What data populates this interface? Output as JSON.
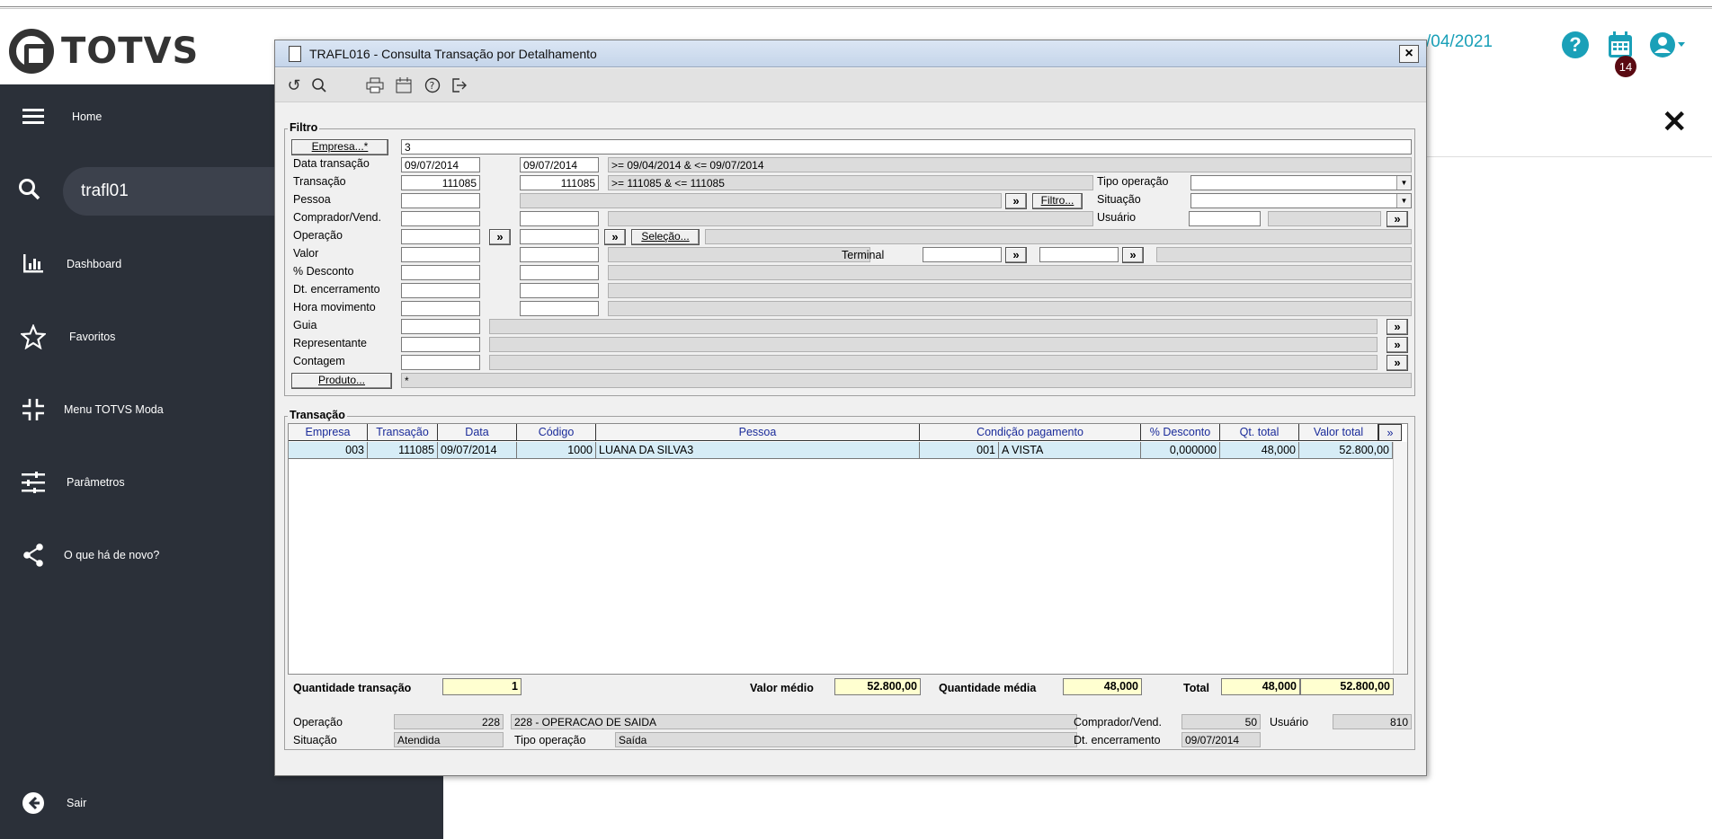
{
  "header": {
    "brand": "TOTVS",
    "date": "/04/2021",
    "help_glyph": "?",
    "calendar_badge": "14",
    "close_glyph": "✕"
  },
  "sidebar": {
    "home": "Home",
    "search_value": "trafl01",
    "items": [
      "Dashboard",
      "Favoritos",
      "Menu TOTVS Moda",
      "Parâmetros",
      "O que há de novo?"
    ],
    "exit": "Sair"
  },
  "dialog": {
    "title": "TRAFL016 - Consulta Transação por Detalhamento",
    "close_glyph": "×",
    "filter": {
      "group": "Filtro",
      "empresa_btn": "Empresa...*",
      "empresa_value": "3",
      "labels": [
        "Data transação",
        "Transação",
        "Pessoa",
        "Comprador/Vend.",
        "Operação",
        "Valor",
        "% Desconto",
        "Dt. encerramento",
        "Hora movimento",
        "Guia",
        "Representante",
        "Contagem"
      ],
      "data_from": "09/07/2014",
      "data_to": "09/07/2014",
      "data_desc": ">= 09/04/2014 & <= 09/07/2014",
      "trans_from": "111085",
      "trans_to": "111085",
      "trans_desc": ">= 111085 & <= 111085",
      "tipo_operacao": "Tipo operação",
      "situacao": "Situação",
      "usuario": "Usuário",
      "filtro_btn": "Filtro...",
      "selecao_btn": "Seleção...",
      "terminal": "Terminal",
      "produto_btn": "Produto...",
      "produto_value": "*",
      "arrow": "»"
    },
    "grid": {
      "group": "Transação",
      "headers": [
        "Empresa",
        "Transação",
        "Data",
        "Código",
        "Pessoa",
        "Condição pagamento",
        "% Desconto",
        "Qt. total",
        "Valor total",
        "»"
      ],
      "row": [
        "003",
        "111085",
        "09/07/2014",
        "1000",
        "LUANA DA SILVA3",
        "001",
        "A VISTA",
        "0,000000",
        "48,000",
        "52.800,00"
      ]
    },
    "totals": {
      "qtd_label": "Quantidade transação",
      "qtd_value": "1",
      "vmedio_label": "Valor médio",
      "vmedio_value": "52.800,00",
      "qmedia_label": "Quantidade média",
      "qmedia_value": "48,000",
      "total_label": "Total",
      "total_qt": "48,000",
      "total_valor": "52.800,00"
    },
    "detail": {
      "operacao_label": "Operação",
      "operacao_code": "228",
      "operacao_desc": "228 - OPERACAO DE SAIDA",
      "comprador_label": "Comprador/Vend.",
      "comprador_value": "50",
      "usuario_label": "Usuário",
      "usuario_value": "810",
      "situacao_label": "Situação",
      "situacao_value": "Atendida",
      "tipo_label": "Tipo operação",
      "tipo_value": "Saída",
      "dtenc_label": "Dt. encerramento",
      "dtenc_value": "09/07/2014"
    }
  }
}
